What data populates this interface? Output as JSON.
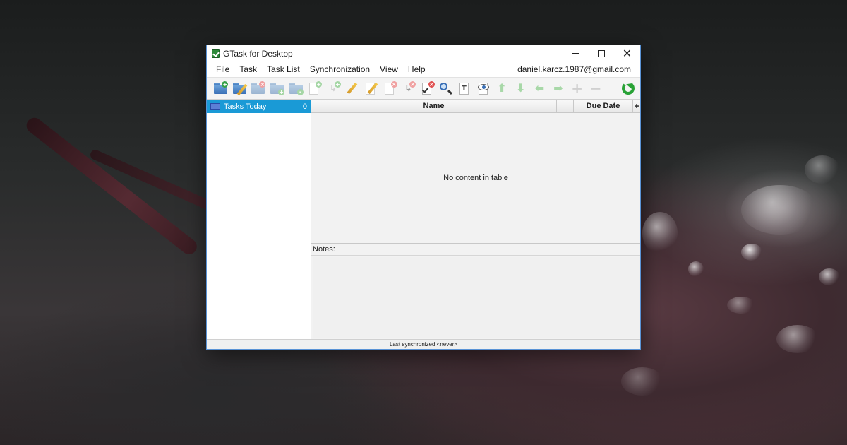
{
  "window": {
    "title": "GTask for Desktop"
  },
  "menubar": {
    "items": [
      "File",
      "Task",
      "Task List",
      "Synchronization",
      "View",
      "Help"
    ],
    "account": "daniel.karcz.1987@gmail.com"
  },
  "toolbar": {
    "icons": [
      "new-task-list-icon",
      "edit-task-list-icon",
      "delete-task-list-icon",
      "move-task-list-icon",
      "task-list-properties-icon",
      "new-task-icon",
      "new-subtask-icon",
      "edit-task-icon",
      "edit-notes-icon",
      "delete-task-icon",
      "delete-subtask-icon",
      "clear-completed-icon",
      "search-icon",
      "filter-icon",
      "view-completed-icon",
      "move-up-icon",
      "move-down-icon",
      "outdent-icon",
      "indent-icon",
      "expand-icon",
      "collapse-icon",
      "synchronize-icon"
    ]
  },
  "sidebar": {
    "items": [
      {
        "label": "Tasks Today",
        "count": "0"
      }
    ]
  },
  "table": {
    "columns": [
      "Name",
      "",
      "Due Date"
    ],
    "empty_message": "No content in table"
  },
  "notes": {
    "label": "Notes:",
    "value": ""
  },
  "status": {
    "text": "Last synchronized <never>"
  },
  "colors": {
    "selection": "#1a9ad6",
    "window_border": "#5a93d6",
    "sync_green": "#28a236"
  }
}
